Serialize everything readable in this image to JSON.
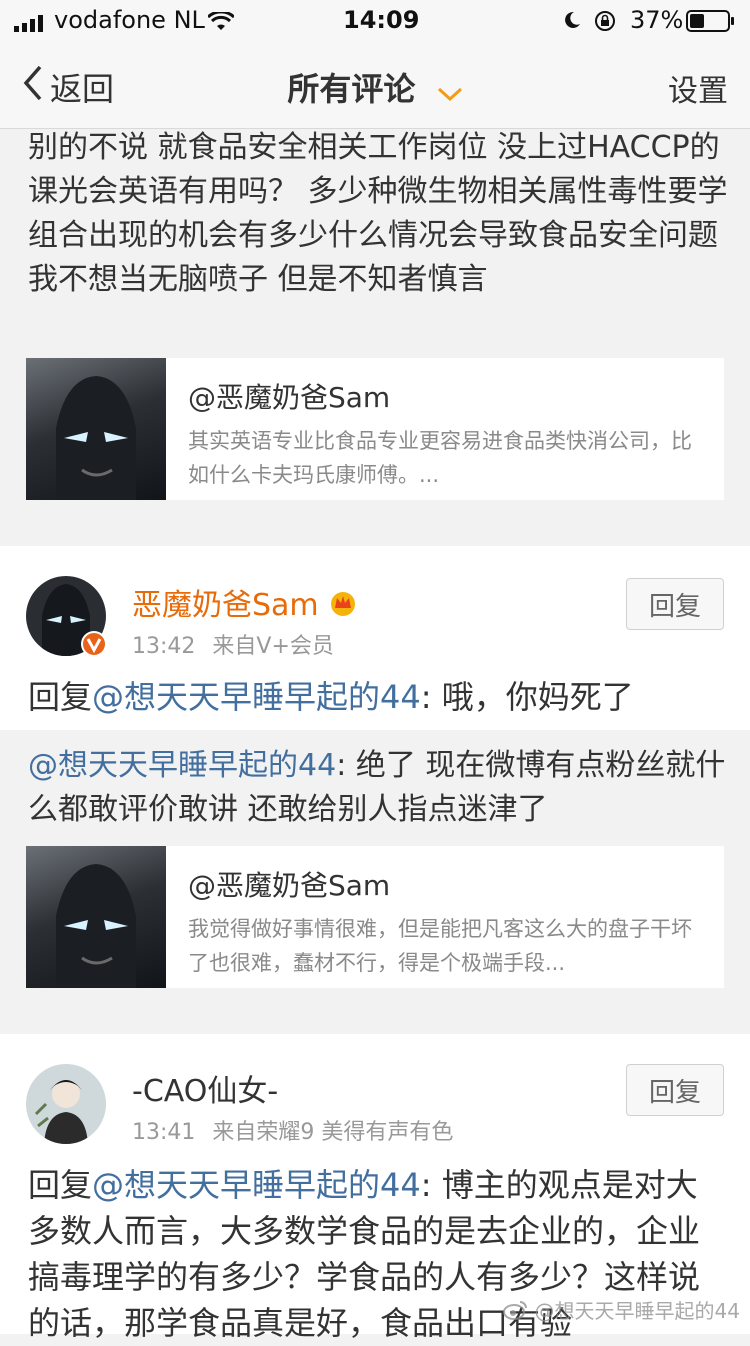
{
  "status": {
    "carrier": "vodafone NL",
    "time": "14:09",
    "battery": "37%"
  },
  "nav": {
    "back": "返回",
    "title": "所有评论",
    "settings": "设置"
  },
  "top_quote": {
    "text": "别的不说 就食品安全相关工作岗位 没上过HACCP的课光会英语有用吗？ 多少种微生物相关属性毒性要学 组合出现的机会有多少什么情况会导致食品安全问题 我不想当无脑喷子 但是不知者慎言"
  },
  "card1": {
    "user": "@恶魔奶爸Sam",
    "snippet": "其实英语专业比食品专业更容易进食品类快消公司，比如什么卡夫玛氏康师傅。..."
  },
  "comment1": {
    "name": "恶魔奶爸Sam",
    "time": "13:42",
    "source": "来自V+会员",
    "reply_button": "回复",
    "reply_prefix": "回复",
    "mention": "@想天天早睡早起的44",
    "reply_text": ": 哦，你妈死了",
    "quoted_mention": "@想天天早睡早起的44",
    "quoted_text": ": 绝了 现在微博有点粉丝就什么都敢评价敢讲 还敢给别人指点迷津了"
  },
  "card2": {
    "user": "@恶魔奶爸Sam",
    "snippet": "我觉得做好事情很难，但是能把凡客这么大的盘子干坏了也很难，蠢材不行，得是个极端手段..."
  },
  "comment2": {
    "name": "-CAO仙女-",
    "time": "13:41",
    "source": "来自荣耀9 美得有声有色",
    "reply_button": "回复",
    "reply_prefix": "回复",
    "mention": "@想天天早睡早起的44",
    "reply_text": ": 博主的观点是对大多数人而言，大多数学食品的是去企业的，企业搞毒理学的有多少？学食品的人有多少？这样说的话，那学食品真是好，食品出口有验"
  },
  "watermark": "@想天天早睡早起的44",
  "colors": {
    "link": "#436f9f",
    "vip_name": "#e86b0a",
    "nav_accent": "#f39c12"
  }
}
